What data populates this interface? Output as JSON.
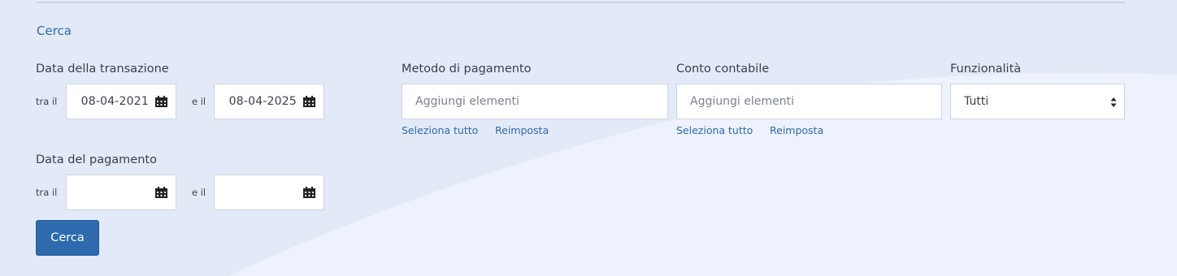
{
  "search": {
    "title": "Cerca",
    "button_label": "Cerca"
  },
  "transaction_date": {
    "label": "Data della transazione",
    "from_label": "tra il",
    "to_label": "e il",
    "from_value": "08-04-2021",
    "to_value": "08-04-2025"
  },
  "payment_date": {
    "label": "Data del pagamento",
    "from_label": "tra il",
    "to_label": "e il",
    "from_value": "",
    "to_value": ""
  },
  "payment_method": {
    "label": "Metodo di pagamento",
    "placeholder": "Aggiungi elementi",
    "select_all": "Seleziona tutto",
    "reset": "Reimposta"
  },
  "ledger_account": {
    "label": "Conto contabile",
    "placeholder": "Aggiungi elementi",
    "select_all": "Seleziona tutto",
    "reset": "Reimposta"
  },
  "functionality": {
    "label": "Funzionalità",
    "selected": "Tutti"
  },
  "icons": {
    "calendar": "calendar-icon",
    "select_arrows": "select-arrows-icon"
  },
  "colors": {
    "accent": "#2c6aa8",
    "button": "#2d6aae",
    "background": "#e3eaf7",
    "background_light": "#edf2fc"
  }
}
